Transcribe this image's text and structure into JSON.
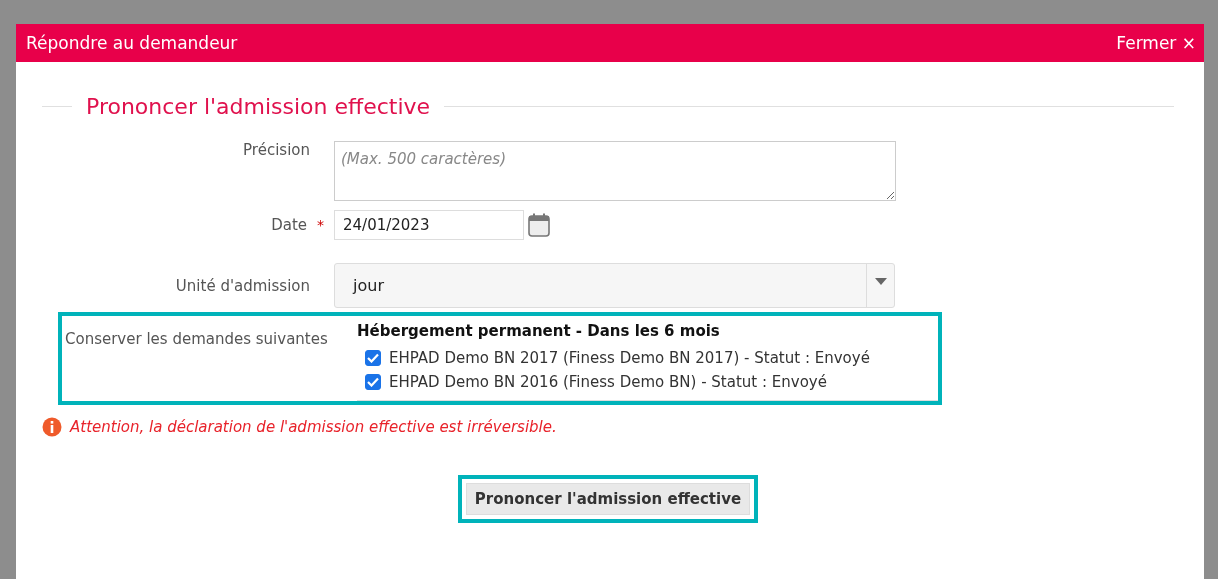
{
  "dialog": {
    "title": "Répondre au demandeur",
    "close_label": "Fermer ×"
  },
  "section": {
    "title": "Prononcer l'admission effective"
  },
  "fields": [
    {
      "kind": "textarea",
      "label": "Précision",
      "placeholder": "(Max. 500 caractères)"
    },
    {
      "kind": "date",
      "label": "Date",
      "value": "24/01/2023",
      "required_mark": "*"
    },
    {
      "kind": "select",
      "label": "Unité d'admission",
      "value": "jour"
    }
  ],
  "requests": {
    "label": "Conserver les demandes suivantes",
    "group_title": "Hébergement permanent - Dans les 6 mois",
    "highlighted": true,
    "items": [
      {
        "label": "EHPAD Demo BN 2017 (Finess Demo BN 2017) - Statut : Envoyé",
        "checked": true
      },
      {
        "label": "EHPAD Demo BN 2016 (Finess Demo BN) - Statut : Envoyé",
        "checked": true
      }
    ]
  },
  "warning": "Attention, la déclaration de l'admission effective est irréversible.",
  "submit": {
    "label": "Prononcer l'admission effective",
    "highlighted": true
  }
}
